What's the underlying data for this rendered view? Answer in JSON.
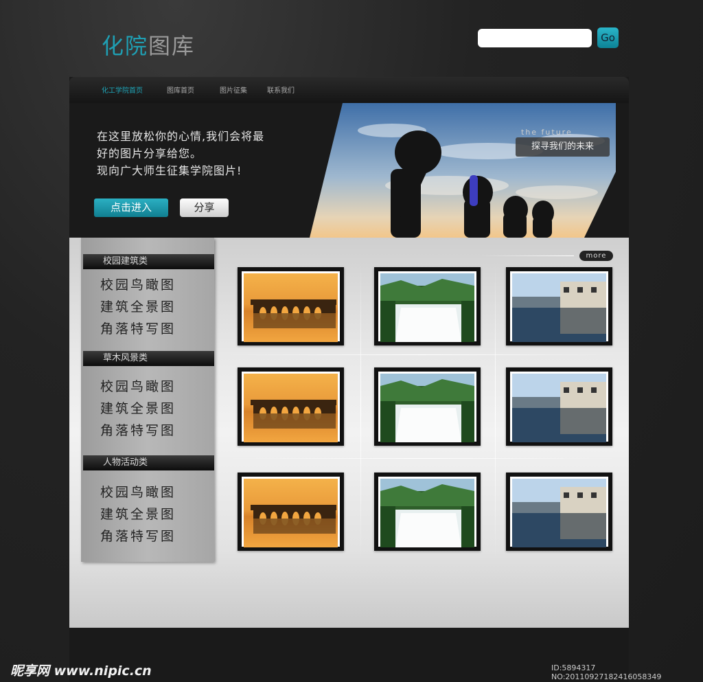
{
  "logo": {
    "part1": "化院",
    "part2": "图库"
  },
  "search": {
    "placeholder": "",
    "go_label": "Go"
  },
  "nav": {
    "items": [
      "化工学院首页",
      "图库首页",
      "图片征集",
      "联系我们"
    ]
  },
  "banner": {
    "lines": [
      "在这里放松你的心情,我们会将最",
      "好的图片分享给您。",
      "现向广大师生征集学院图片!"
    ],
    "enter_label": "点击进入",
    "share_label": "分享",
    "future_label": "the future",
    "future_text": "探寻我们的未来"
  },
  "sidebar": {
    "categories": [
      {
        "title": "校园建筑类",
        "links": [
          "校园鸟瞰图",
          "建筑全景图",
          "角落特写图"
        ]
      },
      {
        "title": "草木风景类",
        "links": [
          "校园鸟瞰图",
          "建筑全景图",
          "角落特写图"
        ]
      },
      {
        "title": "人物活动类",
        "links": [
          "校园鸟瞰图",
          "建筑全景图",
          "角落特写图"
        ]
      }
    ]
  },
  "gallery": {
    "more_label": "more",
    "thumbs": [
      "bridge-sunset-photo",
      "waterfall-photo",
      "village-reflection-photo"
    ]
  },
  "footer": {
    "watermark": "昵享网 www.nipic.cn",
    "image_id": "ID:5894317 NO:20110927182416058349"
  },
  "colors": {
    "accent": "#1f9fb3",
    "background": "#1c1c1c",
    "panel": "#e6e6e6"
  }
}
